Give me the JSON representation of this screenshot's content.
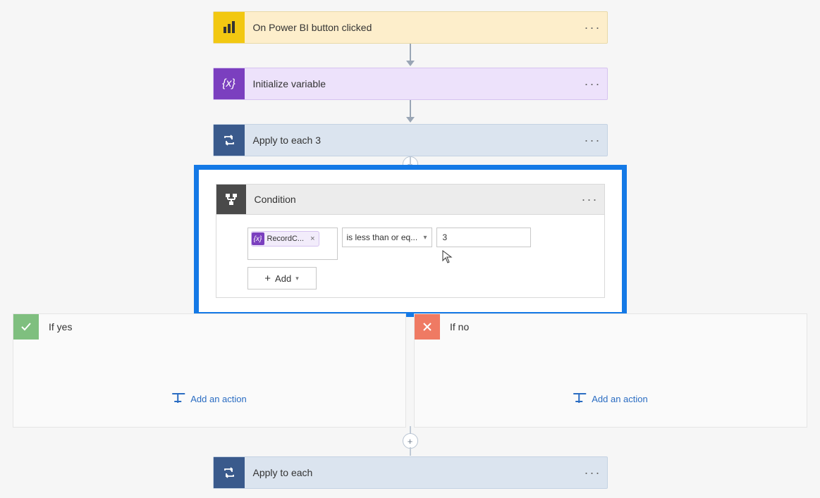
{
  "trigger": {
    "title": "On Power BI button clicked"
  },
  "init": {
    "title": "Initialize variable"
  },
  "apply3": {
    "title": "Apply to each 3"
  },
  "condition": {
    "title": "Condition",
    "left_token": "RecordC...",
    "operator": "is less than or eq...",
    "value": "3",
    "add_label": "Add"
  },
  "branches": {
    "yes": {
      "title": "If yes",
      "add_action": "Add an action"
    },
    "no": {
      "title": "If no",
      "add_action": "Add an action"
    }
  },
  "apply": {
    "title": "Apply to each"
  }
}
